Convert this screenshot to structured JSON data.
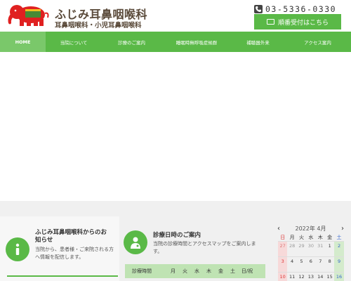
{
  "header": {
    "title": "ふじみ耳鼻咽喉科",
    "subtitle": "耳鼻咽喉科・小児耳鼻咽喉科",
    "phone": "03-5336-0330",
    "reserve_label": "順番受付はこちら"
  },
  "nav": {
    "items": [
      {
        "label": "HOME",
        "active": true
      },
      {
        "label": "当院について"
      },
      {
        "label": "診療のご案内"
      },
      {
        "label": "睡眠時無呼吸症候群"
      },
      {
        "label": "補聴器外来"
      },
      {
        "label": "アクセス案内"
      }
    ]
  },
  "news": {
    "title": "ふじみ耳鼻咽喉科からのお知らせ",
    "text": "当院から、患者様・ご来院される方へ情報を配信します。"
  },
  "clinic": {
    "title": "診療日時のご案内",
    "text": "当院の診療時間とアクセスマップをご案内します。",
    "hours_label": "診療時間",
    "days": [
      "月",
      "火",
      "水",
      "木",
      "金",
      "土"
    ],
    "last_day": "日/祝"
  },
  "calendar": {
    "month_label": "2022年 4月",
    "prev": "‹",
    "next": "›",
    "weekdays": [
      "日",
      "月",
      "火",
      "水",
      "木",
      "金",
      "土"
    ],
    "row1": [
      "27",
      "28",
      "29",
      "30",
      "31",
      "1",
      "2"
    ],
    "row2": [
      "3",
      "4",
      "5",
      "6",
      "7",
      "8",
      "9"
    ],
    "row3": [
      "10",
      "11",
      "12",
      "13",
      "14",
      "15",
      "16"
    ]
  },
  "colors": {
    "green": "#5ab947",
    "light_green": "#bfe3b3"
  }
}
